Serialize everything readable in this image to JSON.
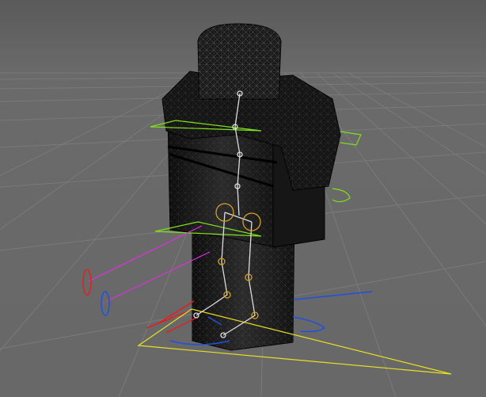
{
  "viewport": {
    "colors": {
      "background_top": "#5d5d5d",
      "background_bottom": "#6e6e6e",
      "grid": "#7c7c7c",
      "mesh": "#1a1a1a",
      "bone": "#d8d8d8",
      "joint": "#d4a020",
      "control_green": "#7ee01a",
      "control_magenta": "#e030e0",
      "control_red": "#e02020",
      "control_blue": "#2050e0",
      "control_yellow": "#e8e020"
    }
  }
}
